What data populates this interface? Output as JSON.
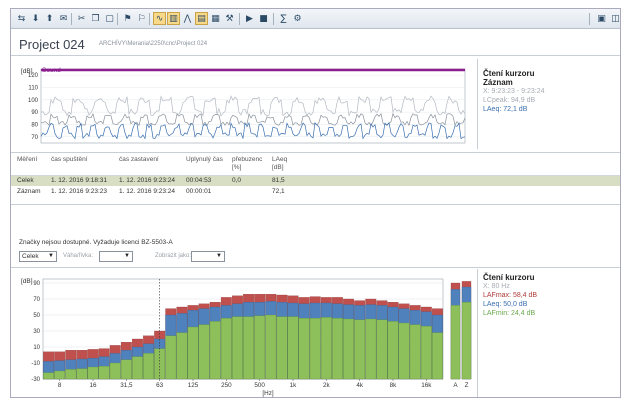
{
  "toolbar": {
    "buttons": [
      {
        "icon": "dock-panels-icon",
        "glyph": "⇆",
        "active": false
      },
      {
        "icon": "download-icon",
        "glyph": "⬇",
        "active": false
      },
      {
        "icon": "upload-icon",
        "glyph": "⬆",
        "active": false
      },
      {
        "icon": "mail-icon",
        "glyph": "✉",
        "active": false
      },
      {
        "icon": "cut-icon",
        "glyph": "✂",
        "active": false
      },
      {
        "icon": "copy-icon",
        "glyph": "❐",
        "active": false
      },
      {
        "icon": "paste-icon",
        "glyph": "▢",
        "active": false
      },
      {
        "icon": "marker-icon",
        "glyph": "⚑",
        "active": false
      },
      {
        "icon": "marker-add-icon",
        "glyph": "⚐",
        "active": false
      },
      {
        "icon": "profile-view-icon",
        "glyph": "∿",
        "active": true
      },
      {
        "icon": "spectrum-view-icon",
        "glyph": "▥",
        "active": true
      },
      {
        "icon": "statistics-view-icon",
        "glyph": "⋀",
        "active": false
      },
      {
        "icon": "table-view-icon",
        "glyph": "▤",
        "active": true
      },
      {
        "icon": "report-icon",
        "glyph": "▦",
        "active": false
      },
      {
        "icon": "tools-icon",
        "glyph": "⚒",
        "active": false
      },
      {
        "icon": "play-icon",
        "glyph": "▶",
        "active": false
      },
      {
        "icon": "stop-icon",
        "glyph": "■",
        "active": false
      },
      {
        "icon": "calc-icon",
        "glyph": "∑",
        "active": false
      },
      {
        "icon": "settings-icon",
        "glyph": "⚙",
        "active": false
      },
      {
        "icon": "window-icon",
        "glyph": "▣",
        "active": false
      },
      {
        "icon": "panel-icon",
        "glyph": "◫",
        "active": false
      }
    ]
  },
  "project": {
    "title": "Project 024",
    "path": "ARCHÍVY\\Merania\\2250\\cnc\\Project 024"
  },
  "profile": {
    "unit_label": "[dB]",
    "series_label": "Sound",
    "yticks": [
      "120",
      "110",
      "100",
      "90",
      "80",
      "70"
    ]
  },
  "cursor_top": {
    "title": "Čtení kurzoru",
    "subtitle": "Záznam",
    "x": "X: 9:23:23 - 9:23:24",
    "lcpeak": "LCpeak: 94,9 dB",
    "laeq": "LAeq: 72,1 dB"
  },
  "table": {
    "headers": {
      "col1": "Měření",
      "col2": "čas spuštění",
      "col3": "čas zastavení",
      "col4": "Uplynulý čas",
      "col5a": "přebuzenc",
      "col5b": "[%]",
      "col6a": "LAeq",
      "col6b": "[dB]"
    },
    "rows": [
      {
        "name": "Celek",
        "start": "1. 12. 2016 9:18:31",
        "stop": "1. 12. 2016 9:23:24",
        "elapsed": "00:04:53",
        "overload": "0,0",
        "laeq": "81,5"
      },
      {
        "name": "Záznam",
        "start": "1. 12. 2016 9:23:23",
        "stop": "1. 12. 2016 9:23:24",
        "elapsed": "00:00:01",
        "overload": "",
        "laeq": "72,1"
      }
    ]
  },
  "notice": "Značky nejsou dostupné. Vyžaduje licenci BZ-5503-A",
  "controls": {
    "select1": "Celek",
    "weighting_label": "Váha/řivka:",
    "display_label": "Zobrazit jako:"
  },
  "cursor_bottom": {
    "title": "Čtení kurzoru",
    "x": "X: 80 Hz",
    "lafmax": "LAFmax: 58,4 dB",
    "laeq": "LAeq: 50,0 dB",
    "lafmin": "LAFmin: 24,4 dB"
  },
  "colors": {
    "accent_purple": "#8b1f8f",
    "max_red": "#c0504d",
    "eq_blue": "#4f81bd",
    "min_green": "#8dc05a"
  },
  "chart_data": {
    "type": "bar",
    "title": "",
    "xlabel": "[Hz]",
    "ylabel": "[dB]",
    "ylim": [
      -30,
      95
    ],
    "yticks": [
      90,
      70,
      50,
      30,
      10,
      -10,
      -30
    ],
    "xtick_labels": [
      "8",
      "16",
      "31,5",
      "63",
      "125",
      "250",
      "500",
      "1k",
      "2k",
      "4k",
      "8k",
      "16k",
      "A",
      "Z"
    ],
    "cursor_band": "80 Hz",
    "legend": "none",
    "grid": true,
    "bands": [
      "6.3",
      "8",
      "10",
      "12.5",
      "16",
      "20",
      "25",
      "31.5",
      "40",
      "50",
      "63",
      "80",
      "100",
      "125",
      "160",
      "200",
      "250",
      "315",
      "400",
      "500",
      "630",
      "800",
      "1k",
      "1.25k",
      "1.6k",
      "2k",
      "2.5k",
      "3.15k",
      "4k",
      "5k",
      "6.3k",
      "8k",
      "10k",
      "12.5k",
      "16k",
      "20k"
    ],
    "series": [
      {
        "name": "LAFmin",
        "values": [
          -22,
          -20,
          -18,
          -17,
          -15,
          -14,
          -10,
          -6,
          -2,
          2,
          8,
          24,
          28,
          35,
          38,
          42,
          46,
          48,
          48,
          49,
          50,
          48,
          48,
          46,
          46,
          47,
          46,
          45,
          44,
          45,
          44,
          42,
          40,
          38,
          36,
          28
        ]
      },
      {
        "name": "LAeq",
        "values": [
          -8,
          -7,
          -6,
          -5,
          -4,
          -2,
          2,
          6,
          10,
          14,
          20,
          50,
          52,
          56,
          58,
          60,
          62,
          64,
          66,
          66,
          67,
          66,
          65,
          64,
          65,
          65,
          64,
          63,
          62,
          63,
          62,
          60,
          58,
          56,
          54,
          50
        ]
      },
      {
        "name": "LAFmax",
        "values": [
          4,
          4,
          6,
          6,
          7,
          8,
          12,
          16,
          20,
          24,
          30,
          58,
          60,
          62,
          64,
          66,
          72,
          74,
          76,
          76,
          76,
          75,
          74,
          72,
          73,
          72,
          72,
          70,
          68,
          70,
          68,
          66,
          64,
          62,
          60,
          58
        ]
      }
    ],
    "totals": {
      "A": {
        "LAFmin": 62,
        "LAeq": 82,
        "LAFmax": 90
      },
      "Z": {
        "LAFmin": 66,
        "LAeq": 85,
        "LAFmax": 92
      }
    }
  }
}
